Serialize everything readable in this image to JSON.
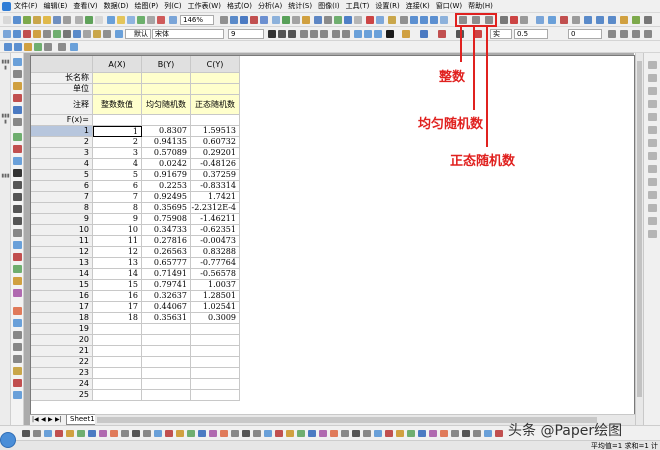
{
  "menu": [
    "文件(F)",
    "编辑(E)",
    "查看(V)",
    "数据(D)",
    "绘图(P)",
    "列(C)",
    "工作表(W)",
    "格式(O)",
    "分析(A)",
    "统计(S)",
    "图像(I)",
    "工具(T)",
    "设置(R)",
    "连接(K)",
    "窗口(W)",
    "帮助(H)"
  ],
  "toolbar": {
    "zoom": "146%",
    "font_default": "默认",
    "font_name": "宋体",
    "font_size": "9",
    "line_style": "实",
    "line_width": "0.5",
    "value_field": "0"
  },
  "sheet": {
    "columns": [
      "A(X)",
      "B(Y)",
      "C(Y)"
    ],
    "label_rows": [
      "长名称",
      "单位",
      "注释",
      "F(x)="
    ],
    "comments": [
      "整数数值",
      "均匀随机数",
      "正态随机数"
    ],
    "row_numbers": [
      "1",
      "2",
      "3",
      "4",
      "5",
      "6",
      "7",
      "8",
      "9",
      "10",
      "11",
      "12",
      "13",
      "14",
      "15",
      "16",
      "17",
      "18",
      "19",
      "20",
      "21",
      "22",
      "23",
      "24",
      "25"
    ],
    "col_a": [
      "1",
      "2",
      "3",
      "4",
      "5",
      "6",
      "7",
      "8",
      "9",
      "10",
      "11",
      "12",
      "13",
      "14",
      "15",
      "16",
      "17",
      "18"
    ],
    "col_b": [
      "0.8307",
      "0.94135",
      "0.57089",
      "0.0242",
      "0.91679",
      "0.2253",
      "0.92495",
      "0.35695",
      "0.75908",
      "0.34733",
      "0.27816",
      "0.26563",
      "0.65777",
      "0.71491",
      "0.79741",
      "0.32637",
      "0.44067",
      "0.35631"
    ],
    "col_c": [
      "1.59513",
      "0.60732",
      "0.29201",
      "-0.48126",
      "0.37259",
      "-0.83314",
      "1.7421",
      "-2.2312E-4",
      "-1.46211",
      "-0.62351",
      "-0.00473",
      "0.83288",
      "-0.77764",
      "-0.56578",
      "1.0037",
      "1.28501",
      "1.02541",
      "0.3009"
    ],
    "tab_name": "Sheet1"
  },
  "annotations": {
    "integer": "整数",
    "uniform": "均匀随机数",
    "normal": "正态随机数",
    "color": "#e0211f"
  },
  "watermark": "头条 @Paper绘图",
  "status": "平均值=1 求和=1 计"
}
